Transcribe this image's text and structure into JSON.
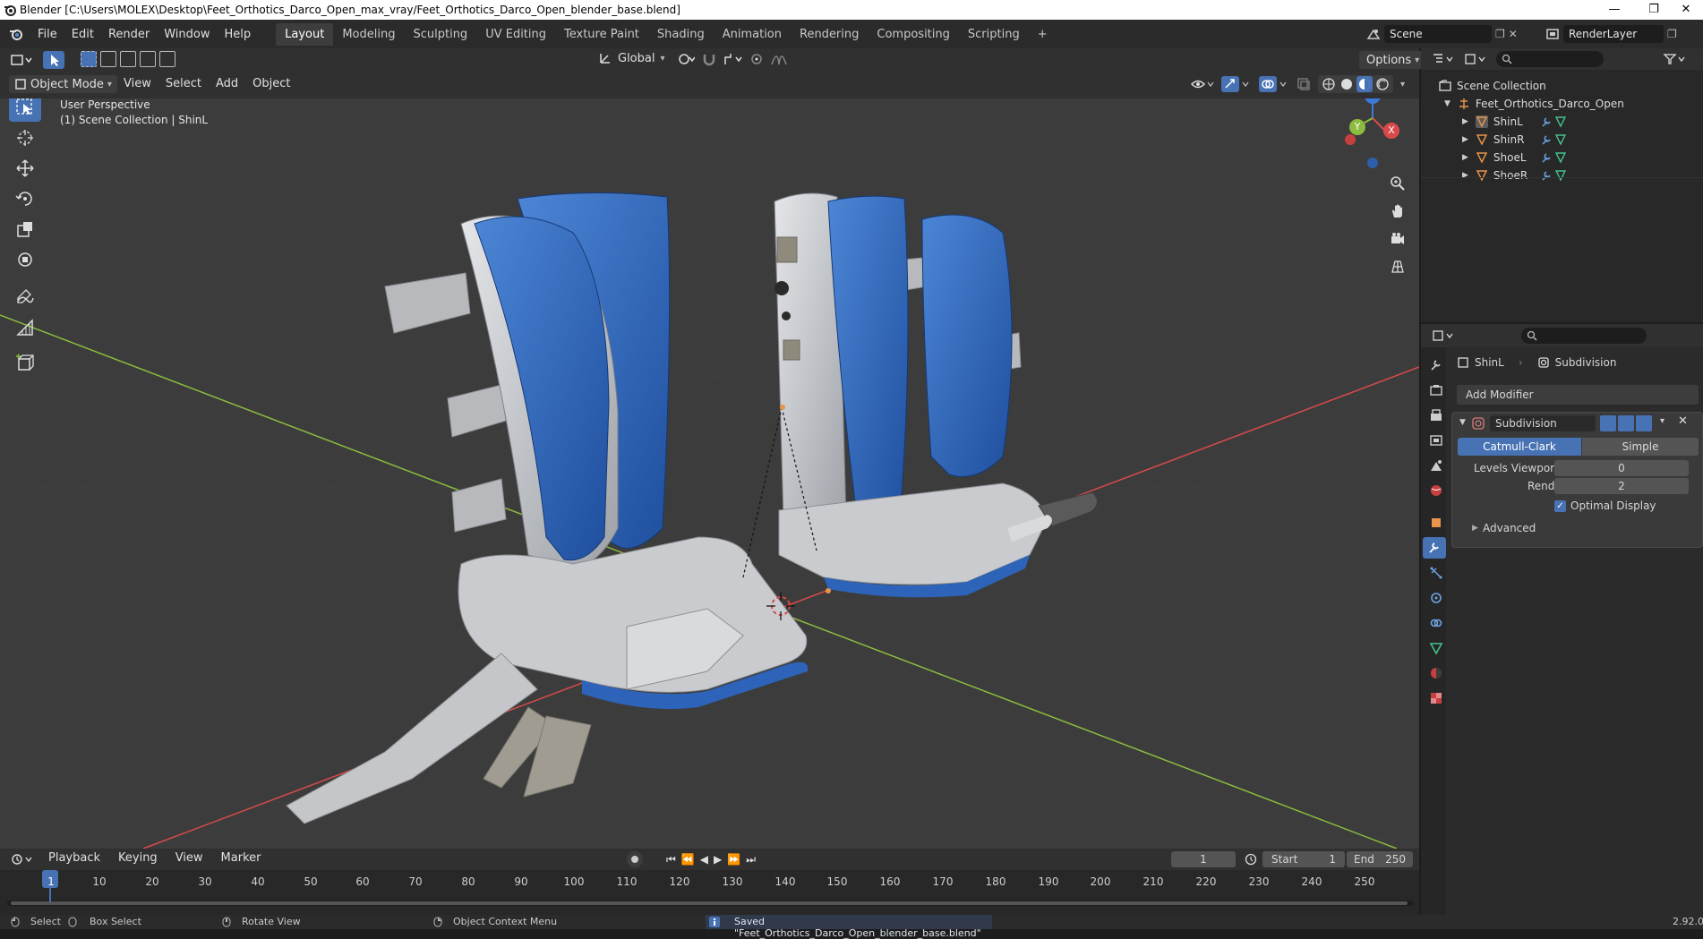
{
  "window": {
    "title": "Blender [C:\\Users\\MOLEX\\Desktop\\Feet_Orthotics_Darco_Open_max_vray/Feet_Orthotics_Darco_Open_blender_base.blend]",
    "minimize": "—",
    "restore": "❐",
    "close": "✕"
  },
  "menu": [
    "File",
    "Edit",
    "Render",
    "Window",
    "Help"
  ],
  "workspaces": [
    "Layout",
    "Modeling",
    "Sculpting",
    "UV Editing",
    "Texture Paint",
    "Shading",
    "Animation",
    "Rendering",
    "Compositing",
    "Scripting"
  ],
  "workspace_add": "+",
  "scene": {
    "name": "Scene",
    "render_layer": "RenderLayer"
  },
  "viewport_header": {
    "transform_orientation": "Global",
    "options_label": "Options",
    "mode": "Object Mode",
    "menus": [
      "View",
      "Select",
      "Add",
      "Object"
    ]
  },
  "viewport": {
    "perspective": "User Perspective",
    "collection_info": "(1) Scene Collection | ShinL",
    "gizmo": {
      "z": "Z",
      "y": "Y",
      "x": "X"
    }
  },
  "outliner": {
    "root": "Scene Collection",
    "collection": "Feet_Orthotics_Darco_Open",
    "objects": [
      "ShinL",
      "ShinR",
      "ShoeL",
      "ShoeR"
    ]
  },
  "properties": {
    "object_name": "ShinL",
    "modifier_breadcrumb": "Subdivision",
    "add_modifier": "Add Modifier",
    "modifier": {
      "name": "Subdivision",
      "type_options": [
        "Catmull-Clark",
        "Simple"
      ],
      "selected_type": "Catmull-Clark",
      "levels_viewport_label": "Levels Viewport",
      "levels_viewport_value": "0",
      "render_label": "Render",
      "render_value": "2",
      "optimal_display_label": "Optimal Display",
      "optimal_display_checked": true,
      "advanced_label": "Advanced"
    }
  },
  "timeline": {
    "menus": [
      "Playback",
      "Keying",
      "View",
      "Marker"
    ],
    "current_frame": "1",
    "start_label": "Start",
    "start_value": "1",
    "end_label": "End",
    "end_value": "250",
    "ticks": [
      "1",
      "10",
      "20",
      "30",
      "40",
      "50",
      "60",
      "70",
      "80",
      "90",
      "100",
      "110",
      "120",
      "130",
      "140",
      "150",
      "160",
      "170",
      "180",
      "190",
      "200",
      "210",
      "220",
      "230",
      "240",
      "250"
    ]
  },
  "statusbar": {
    "select": "Select",
    "box_select": "Box Select",
    "rotate_view": "Rotate View",
    "context_menu": "Object Context Menu",
    "message": "Saved \"Feet_Orthotics_Darco_Open_blender_base.blend\"",
    "version": "2.92.0"
  },
  "colors": {
    "accent_blue": "#4772b3",
    "x_axis": "#d84a4a",
    "y_axis": "#8bbb3f",
    "z_axis": "#3d7ad8",
    "object_orange": "#e8944a"
  }
}
